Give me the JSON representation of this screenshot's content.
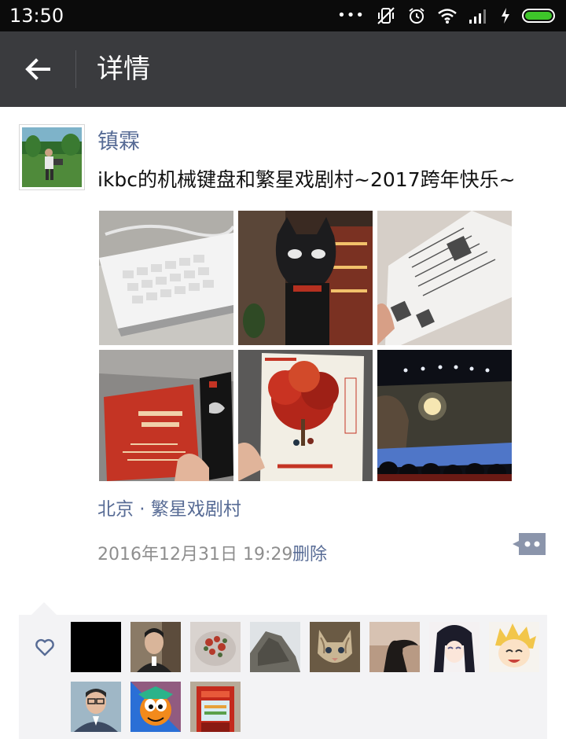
{
  "status_bar": {
    "time": "13:50",
    "icons": [
      "more-dots-icon",
      "vibrate-off-icon",
      "alarm-icon",
      "wifi-icon",
      "signal-icon",
      "charging-icon",
      "battery-icon"
    ],
    "battery_level": 1.0,
    "battery_color": "#3ec52a"
  },
  "title_bar": {
    "back_icon": "arrow-left-icon",
    "title": "详情",
    "background": "#3a3b3e"
  },
  "post": {
    "username": "镇霖",
    "text": "ikbc的机械键盘和繁星戏剧村~2017跨年快乐~",
    "photos": [
      "keyboard-photo",
      "cat-figure-photo",
      "ticket-photo",
      "red-brochure-photo",
      "poster-photo",
      "stage-photo"
    ],
    "location": "北京 · 繁星戏剧村",
    "timestamp": "2016年12月31日 19:29",
    "delete_label": "删除",
    "comment_icon": "comment-dots-icon",
    "link_color": "#576b95"
  },
  "likes": {
    "icon": "heart-outline-icon",
    "avatars": [
      "like-avatar-1",
      "like-avatar-2",
      "like-avatar-3",
      "like-avatar-4",
      "like-avatar-5",
      "like-avatar-6",
      "like-avatar-7",
      "like-avatar-8",
      "like-avatar-9",
      "like-avatar-10",
      "like-avatar-11"
    ]
  }
}
